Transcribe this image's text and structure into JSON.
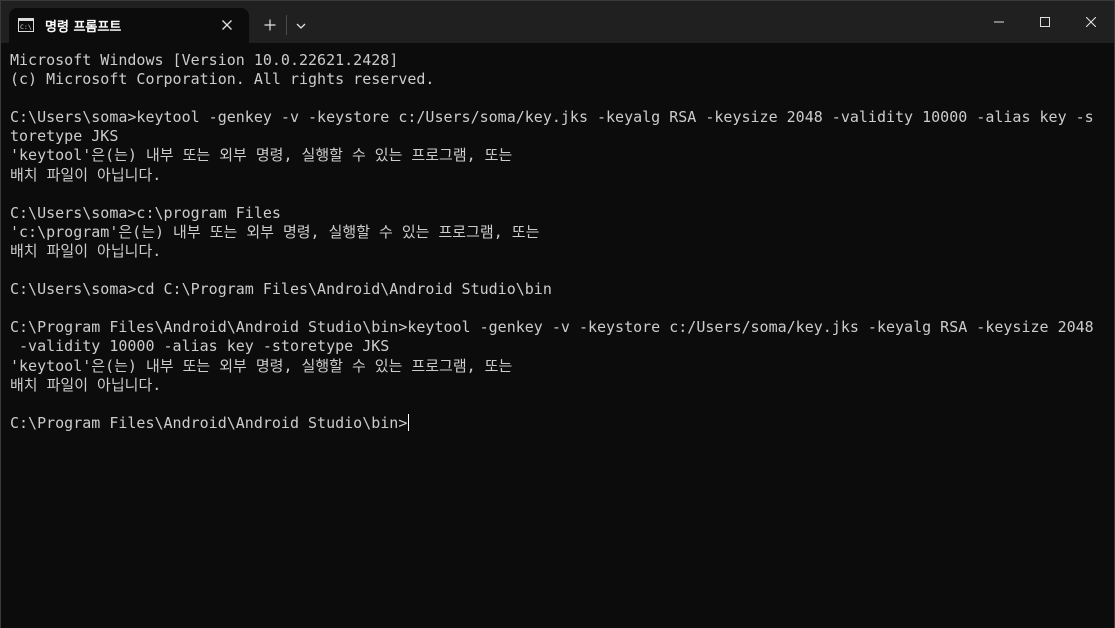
{
  "tab": {
    "title": "명령 프롬프트",
    "icon": "cmd-icon"
  },
  "titlebar": {
    "new_tab_icon": "plus-icon",
    "dropdown_icon": "chevron-down-icon",
    "minimize_icon": "minimize-icon",
    "maximize_icon": "maximize-icon",
    "close_icon": "close-icon"
  },
  "terminal": {
    "lines": [
      "Microsoft Windows [Version 10.0.22621.2428]",
      "(c) Microsoft Corporation. All rights reserved.",
      "",
      "C:\\Users\\soma>keytool -genkey -v -keystore c:/Users/soma/key.jks -keyalg RSA -keysize 2048 -validity 10000 -alias key -s",
      "toretype JKS",
      "'keytool'은(는) 내부 또는 외부 명령, 실행할 수 있는 프로그램, 또는",
      "배치 파일이 아닙니다.",
      "",
      "C:\\Users\\soma>c:\\program Files",
      "'c:\\program'은(는) 내부 또는 외부 명령, 실행할 수 있는 프로그램, 또는",
      "배치 파일이 아닙니다.",
      "",
      "C:\\Users\\soma>cd C:\\Program Files\\Android\\Android Studio\\bin",
      "",
      "C:\\Program Files\\Android\\Android Studio\\bin>keytool -genkey -v -keystore c:/Users/soma/key.jks -keyalg RSA -keysize 2048",
      " -validity 10000 -alias key -storetype JKS",
      "'keytool'은(는) 내부 또는 외부 명령, 실행할 수 있는 프로그램, 또는",
      "배치 파일이 아닙니다.",
      ""
    ],
    "prompt": "C:\\Program Files\\Android\\Android Studio\\bin>"
  }
}
